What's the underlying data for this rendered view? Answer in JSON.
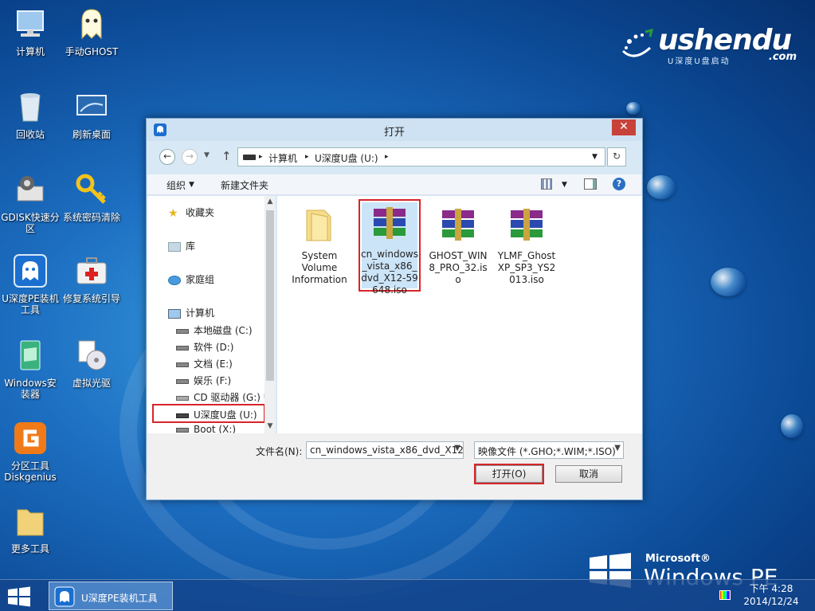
{
  "desktop": {
    "icons": [
      {
        "label": "计算机"
      },
      {
        "label": "手动GHOST"
      },
      {
        "label": "回收站"
      },
      {
        "label": "刷新桌面"
      },
      {
        "label": "GDISK快速分区"
      },
      {
        "label": "系统密码清除"
      },
      {
        "label": "U深度PE装机工具"
      },
      {
        "label": "修复系统引导"
      },
      {
        "label": "Windows安装器"
      },
      {
        "label": "虚拟光驱"
      },
      {
        "label": "分区工具Diskgenius"
      },
      {
        "label": "更多工具"
      }
    ]
  },
  "brand": {
    "name": "ushendu",
    "domain": ".com",
    "tagline": "U深度U盘启动",
    "accent": "#2a9a3a"
  },
  "dialog": {
    "title": "打开",
    "close_label": "✕",
    "address": {
      "root": "计算机",
      "drive": "U深度U盘 (U:)"
    },
    "toolbar": {
      "organize": "组织",
      "new_folder": "新建文件夹"
    },
    "nav": {
      "favorites": "收藏夹",
      "library": "库",
      "homegroup": "家庭组",
      "computer": "计算机",
      "drives": [
        "本地磁盘 (C:)",
        "软件 (D:)",
        "文档 (E:)",
        "娱乐 (F:)",
        "CD 驱动器 (G:) U",
        "U深度U盘 (U:)",
        "Boot (X:)"
      ]
    },
    "files": [
      {
        "name": "System Volume Information",
        "type": "folder"
      },
      {
        "name": "cn_windows_vista_x86_dvd_X12-59648.iso",
        "type": "archive",
        "selected": true
      },
      {
        "name": "GHOST_WIN8_PRO_32.iso",
        "type": "archive"
      },
      {
        "name": "YLMF_GhostXP_SP3_YS2013.iso",
        "type": "archive"
      }
    ],
    "filename_label": "文件名(N):",
    "filename_value": "cn_windows_vista_x86_dvd_X12",
    "filetype_value": "映像文件 (*.GHO;*.WIM;*.ISO)",
    "open_button": "打开(O)",
    "cancel_button": "取消",
    "highlight_color": "#d8242a"
  },
  "taskbar": {
    "active_app": "U深度PE装机工具",
    "time": "下午 4:28",
    "date": "2014/12/24"
  },
  "watermark": {
    "microsoft": "Microsoft®",
    "product": "Windows PE"
  }
}
